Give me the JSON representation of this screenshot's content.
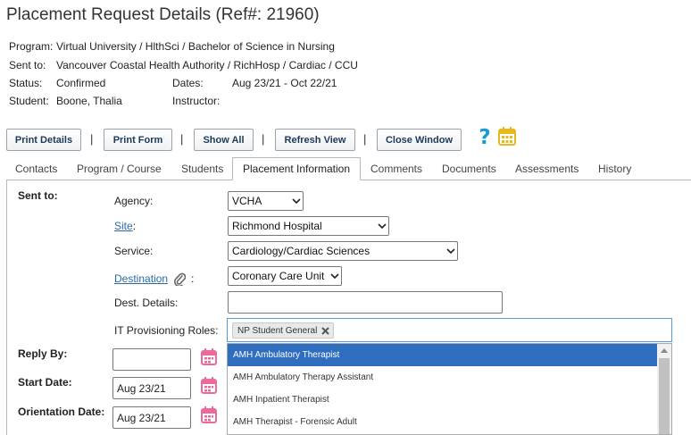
{
  "page": {
    "title": "Placement Request Details (Ref#: 21960)"
  },
  "info": {
    "program_label": "Program:",
    "program_value": "Virtual University / HlthSci / Bachelor of Science in Nursing",
    "sent_label": "Sent to:",
    "sent_value": "Vancouver Coastal Health Authority / RichHosp / Cardiac / CCU",
    "status_label": "Status:",
    "status_value": "Confirmed",
    "dates_label": "Dates:",
    "dates_value": "Aug 23/21 - Oct 22/21",
    "student_label": "Student:",
    "student_value": "Boone, Thalia",
    "instructor_label": "Instructor:",
    "instructor_value": ""
  },
  "toolbar": {
    "print_details": "Print Details",
    "print_form": "Print Form",
    "show_all": "Show All",
    "refresh_view": "Refresh View",
    "close_window": "Close Window",
    "separator": "|"
  },
  "tabs": [
    "Contacts",
    "Program / Course",
    "Students",
    "Placement Information",
    "Comments",
    "Documents",
    "Assessments",
    "History"
  ],
  "form": {
    "sent_to_label": "Sent to:",
    "agency_label": "Agency:",
    "agency_value": "VCHA",
    "site_label": "Site",
    "site_colon": ":",
    "site_value": "Richmond Hospital",
    "service_label": "Service:",
    "service_value": "Cardiology/Cardiac Sciences",
    "destination_label": "Destination",
    "destination_colon": ":",
    "destination_value": "Coronary Care Unit",
    "dest_details_label": "Dest. Details:",
    "dest_details_value": "",
    "it_roles_label": "IT Provisioning Roles:",
    "it_role_tag": "NP Student General",
    "reply_by_label": "Reply By:",
    "reply_by_value": "",
    "start_date_label": "Start Date:",
    "start_date_value": "Aug 23/21",
    "orientation_label": "Orientation Date:",
    "orientation_value": "Aug 23/21"
  },
  "dropdown_options": [
    "AMH Ambulatory Therapist",
    "AMH Ambulatory Therapy Assistant",
    "AMH Inpatient Therapist",
    "AMH Therapist - Forensic Adult"
  ],
  "colors": {
    "help_icon": "#1a9bd1",
    "calendar_icon_toolbar": "#e8b820",
    "calendar_icon_form": "#e96a9b",
    "dropdown_highlight": "#2f6ebf"
  }
}
